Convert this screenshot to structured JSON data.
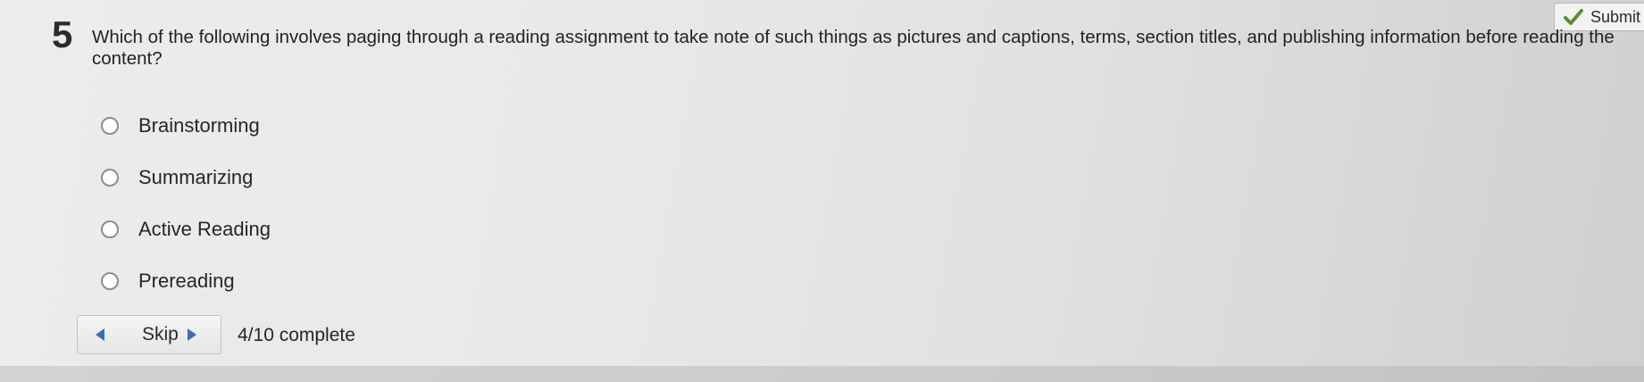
{
  "submit": {
    "label": "Submit",
    "icon": "check-icon",
    "icon_color": "#5a8f2e"
  },
  "question": {
    "number": "5",
    "text": "Which of the following involves paging through a reading assignment to take note of such things as pictures and captions, terms, section titles, and publishing information before reading the content?"
  },
  "options": [
    {
      "label": "Brainstorming"
    },
    {
      "label": "Summarizing"
    },
    {
      "label": "Active Reading"
    },
    {
      "label": "Prereading"
    }
  ],
  "navigation": {
    "skip_label": "Skip",
    "left_icon": "arrow-left-icon",
    "right_icon": "arrow-right-icon",
    "arrow_color": "#3b6fb5"
  },
  "progress": {
    "text": "4/10 complete",
    "completed": 4,
    "total": 10
  }
}
